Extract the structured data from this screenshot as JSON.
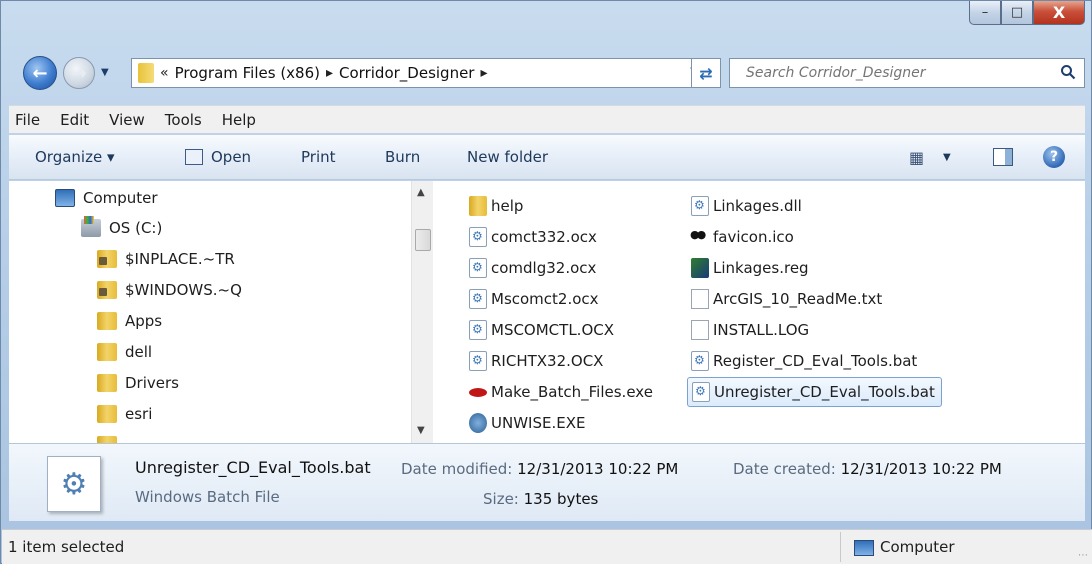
{
  "window": {
    "minimize": "–",
    "maximize": "□",
    "close": "X"
  },
  "address": {
    "overflow": "«",
    "crumbs": [
      "Program Files (x86)",
      "Corridor_Designer"
    ],
    "sep": "▸",
    "dropdown": "▾",
    "refresh": "↻"
  },
  "search": {
    "placeholder": "Search Corridor_Designer"
  },
  "menu": {
    "items": [
      "File",
      "Edit",
      "View",
      "Tools",
      "Help"
    ]
  },
  "toolbar": {
    "organize": "Organize ▾",
    "open": "Open",
    "print": "Print",
    "burn": "Burn",
    "new_folder": "New folder",
    "help": "?"
  },
  "tree": {
    "items": [
      {
        "label": "Computer",
        "icon": "computer-icon"
      },
      {
        "label": "OS (C:)",
        "icon": "drive-icon"
      },
      {
        "label": "$INPLACE.~TR",
        "icon": "locked-folder-icon"
      },
      {
        "label": "$WINDOWS.~Q",
        "icon": "locked-folder-icon"
      },
      {
        "label": "Apps",
        "icon": "folder-icon"
      },
      {
        "label": "dell",
        "icon": "folder-icon"
      },
      {
        "label": "Drivers",
        "icon": "folder-icon"
      },
      {
        "label": "esri",
        "icon": "folder-icon"
      }
    ]
  },
  "files": {
    "col1": [
      {
        "name": "help",
        "icon": "folder-icon"
      },
      {
        "name": "comct332.ocx",
        "icon": "ocx-file-icon"
      },
      {
        "name": "comdlg32.ocx",
        "icon": "ocx-file-icon"
      },
      {
        "name": "Mscomct2.ocx",
        "icon": "ocx-file-icon"
      },
      {
        "name": "MSCOMCTL.OCX",
        "icon": "ocx-file-icon"
      },
      {
        "name": "RICHTX32.OCX",
        "icon": "ocx-file-icon"
      },
      {
        "name": "Make_Batch_Files.exe",
        "icon": "exe-file-icon"
      },
      {
        "name": "UNWISE.EXE",
        "icon": "setup-exe-icon"
      }
    ],
    "col2": [
      {
        "name": "Linkages.dll",
        "icon": "dll-file-icon"
      },
      {
        "name": "favicon.ico",
        "icon": "ico-file-icon"
      },
      {
        "name": "Linkages.reg",
        "icon": "reg-file-icon"
      },
      {
        "name": "ArcGIS_10_ReadMe.txt",
        "icon": "txt-file-icon"
      },
      {
        "name": "INSTALL.LOG",
        "icon": "txt-file-icon"
      },
      {
        "name": "Register_CD_Eval_Tools.bat",
        "icon": "bat-file-icon"
      },
      {
        "name": "Unregister_CD_Eval_Tools.bat",
        "icon": "bat-file-icon",
        "selected": true
      }
    ]
  },
  "details": {
    "name": "Unregister_CD_Eval_Tools.bat",
    "type": "Windows Batch File",
    "modified_label": "Date modified:",
    "modified_value": "12/31/2013 10:22 PM",
    "size_label": "Size:",
    "size_value": "135 bytes",
    "created_label": "Date created:",
    "created_value": "12/31/2013 10:22 PM"
  },
  "status": {
    "selection": "1 item selected",
    "location": "Computer"
  }
}
